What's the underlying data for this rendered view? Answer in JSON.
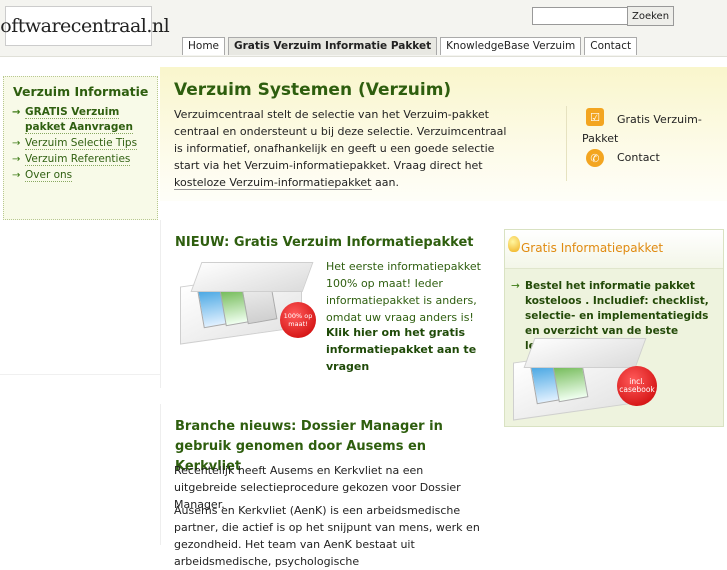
{
  "site": {
    "logo_text": "Softwarecentraal.nl"
  },
  "search": {
    "placeholder": "",
    "button_label": "Zoeken"
  },
  "nav": {
    "tabs": [
      {
        "label": "Home",
        "active": false
      },
      {
        "label": "Gratis Verzuim Informatie Pakket",
        "active": true
      },
      {
        "label": "KnowledgeBase Verzuim",
        "active": false
      },
      {
        "label": "Contact",
        "active": false
      }
    ]
  },
  "sidebar": {
    "title": "Verzuim Informatie",
    "items": [
      {
        "label": "GRATIS Verzuim pakket Aanvragen",
        "bold": true
      },
      {
        "label": "Verzuim Selectie Tips",
        "bold": false
      },
      {
        "label": "Verzuim Referenties",
        "bold": false
      },
      {
        "label": "Over ons",
        "bold": false
      }
    ]
  },
  "main": {
    "title": "Verzuim Systemen (Verzuim)",
    "intro_text": "Verzuimcentraal stelt de selectie van het Verzuim-pakket centraal en ondersteunt u bij deze selectie. Verzuimcentraal is informatief, onafhankelijk en geeft u een goede selectie start via het Verzuim-informatiepakket. Vraag direct het ",
    "intro_link": "kosteloze Verzuim-informatiepakket",
    "intro_end": " aan."
  },
  "quicklinks": {
    "items": [
      {
        "label": "Gratis Verzuim-Pakket",
        "icon": "checkbox-icon"
      },
      {
        "label": "Contact",
        "icon": "phone-icon"
      }
    ]
  },
  "nieuw": {
    "title": "NIEUW: Gratis Verzuim Informatiepakket",
    "text": "Het eerste informatiepakket 100% op maat! Ieder informatiepakket is anders, omdat uw vraag anders is!",
    "cta": "Klik hier om het gratis informatiepakket aan te vragen",
    "badge": "100% op maat!"
  },
  "info_panel": {
    "title": "Gratis Informatiepakket",
    "text": "Bestel het informatie pakket kosteloos . Includief: checklist, selectie- en implementatiegids en overzicht van de beste leveranciers.",
    "badge": "incl. casebook"
  },
  "news": {
    "title": "Branche nieuws: Dossier Manager in gebruik genomen door Ausems en Kerkvliet",
    "paragraph1": "Recentelijk heeft Ausems en Kerkvliet na een uitgebreide selectieprocedure gekozen voor Dossier Manager.",
    "paragraph2": "Ausems en Kerkvliet (AenK) is een arbeidsmedische partner, die actief is op het snijpunt van mens, werk en gezondheid. Het team van AenK bestaat uit arbeidsmedische, psychologische"
  },
  "colors": {
    "heading_green": "#2e5e0e",
    "panel_title_orange": "#e08a10",
    "icon_orange": "#f3a520",
    "badge_red": "#c80000"
  }
}
